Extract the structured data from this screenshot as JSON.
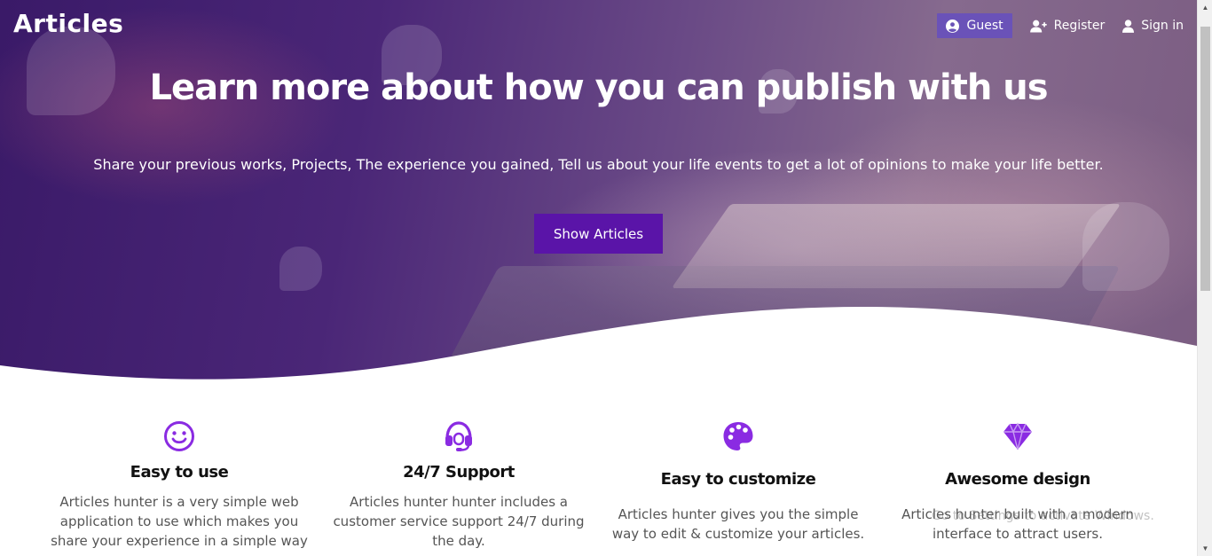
{
  "brand": "Articles",
  "nav": {
    "guest_label": "Guest",
    "register_label": "Register",
    "signin_label": "Sign in"
  },
  "hero": {
    "title": "Learn more about how you can publish with us",
    "subtitle": "Share your previous works, Projects, The experience you gained, Tell us about your life events to get a lot of opinions to make your life better.",
    "cta_label": "Show Articles"
  },
  "features": [
    {
      "icon": "smile-icon",
      "title": "Easy to use",
      "text": "Articles hunter is a very simple web application to use which makes you share your experience in a simple way"
    },
    {
      "icon": "headset-icon",
      "title": "24/7 Support",
      "text": "Articles hunter hunter includes a customer service support 24/7 during the day."
    },
    {
      "icon": "palette-icon",
      "title": "Easy to customize",
      "text": "Articles hunter gives you the simple way to edit & customize your articles."
    },
    {
      "icon": "gem-icon",
      "title": "Awesome design",
      "text": "Articles hunter built with a modern interface to attract users."
    }
  ],
  "watermark": "Go to Settings to activate Windows.",
  "colors": {
    "accent": "#5a14a8",
    "icon": "#8a2be2",
    "guest_badge": "#6a52b8"
  }
}
